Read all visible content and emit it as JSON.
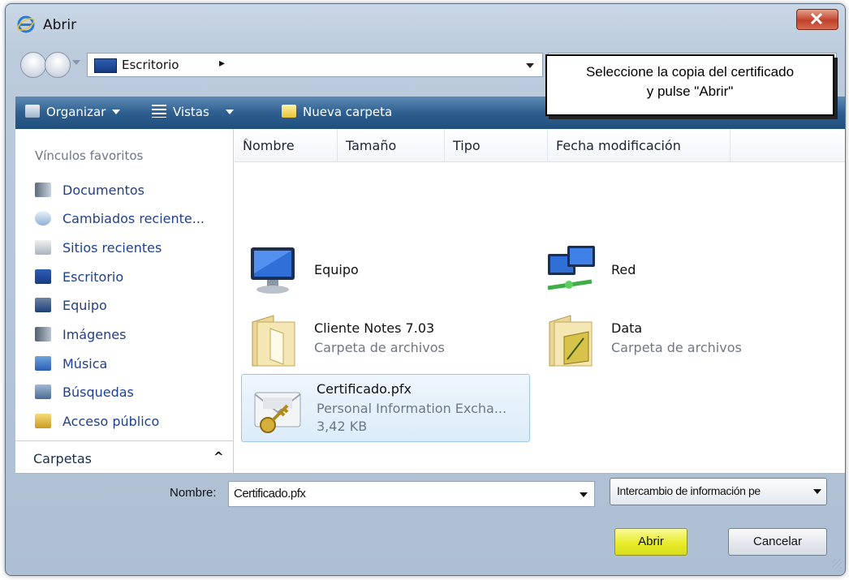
{
  "window": {
    "title": "Abrir",
    "accent": "#2e5f8f"
  },
  "address": {
    "location": "Escritorio",
    "separator": "▸"
  },
  "callout": {
    "line1": "Seleccione la copia del certificado",
    "line2": "y pulse \"Abrir\""
  },
  "toolbar": {
    "organize": "Organizar",
    "views": "Vistas",
    "new_folder": "Nueva carpeta"
  },
  "sidebar": {
    "favorites_title": "Vínculos favoritos",
    "items": [
      {
        "label": "Documentos",
        "icon": "documents-icon"
      },
      {
        "label": "Cambiados reciente...",
        "icon": "recent-changed-icon"
      },
      {
        "label": "Sitios recientes",
        "icon": "recent-places-icon"
      },
      {
        "label": "Escritorio",
        "icon": "desktop-icon"
      },
      {
        "label": "Equipo",
        "icon": "computer-icon"
      },
      {
        "label": "Imágenes",
        "icon": "pictures-icon"
      },
      {
        "label": "Música",
        "icon": "music-icon"
      },
      {
        "label": "Búsquedas",
        "icon": "searches-icon"
      },
      {
        "label": "Acceso público",
        "icon": "public-icon"
      }
    ],
    "folders_label": "Carpetas",
    "folders_chevron": "^"
  },
  "columns": [
    "Nombre",
    "Tamaño",
    "Tipo",
    "Fecha modificación"
  ],
  "files": [
    {
      "name": "Equipo",
      "icon": "computer-icon"
    },
    {
      "name": "Red",
      "icon": "network-icon"
    },
    {
      "name": "Cliente Notes 7.03",
      "type": "Carpeta de archivos",
      "icon": "folder-icon"
    },
    {
      "name": "Data",
      "type": "Carpeta de archivos",
      "icon": "folder-icon"
    },
    {
      "name": "Certificado.pfx",
      "type": "Personal Information Excha...",
      "size": "3,42 KB",
      "icon": "certificate-icon",
      "selected": true
    }
  ],
  "bottom": {
    "name_label": "Nombre:",
    "name_value": "Certificado.pfx",
    "type_value": "Intercambio de información pe",
    "open_button": "Abrir",
    "cancel_button": "Cancelar"
  }
}
